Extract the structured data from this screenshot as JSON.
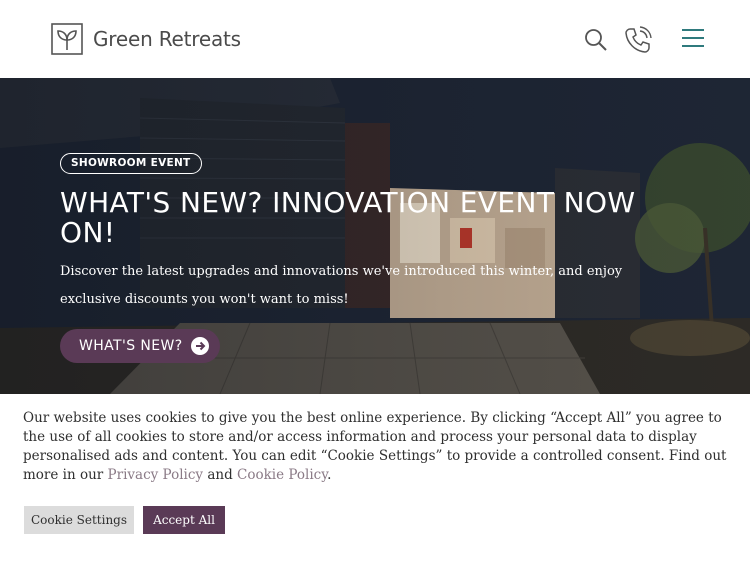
{
  "header": {
    "brand": "Green Retreats",
    "icons": [
      "leaf-logo-icon",
      "search-icon",
      "phone-icon",
      "menu-icon"
    ]
  },
  "hero": {
    "badge": "SHOWROOM EVENT",
    "title": "WHAT'S NEW? INNOVATION EVENT NOW ON!",
    "description": "Discover the latest upgrades and innovations we've introduced this winter, and enjoy exclusive discounts you won't want to miss!",
    "cta_label": "WHAT'S NEW?"
  },
  "cookie_banner": {
    "text_before": "Our website uses cookies to give you the best online experience. By clicking “Accept All” you agree to the use of all cookies to store and/or access information and process your personal data to display personalised ads and content. You can edit “Cookie Settings” to provide a controlled consent. Find out more in our ",
    "privacy_link": "Privacy Policy",
    "text_middle": " and ",
    "cookie_link": "Cookie Policy",
    "text_after": ".",
    "settings_button": "Cookie Settings",
    "accept_button": "Accept All"
  },
  "colors": {
    "brand_purple": "#5a3a56",
    "teal_icon": "#2f7a7d",
    "link": "#8a7a86"
  }
}
